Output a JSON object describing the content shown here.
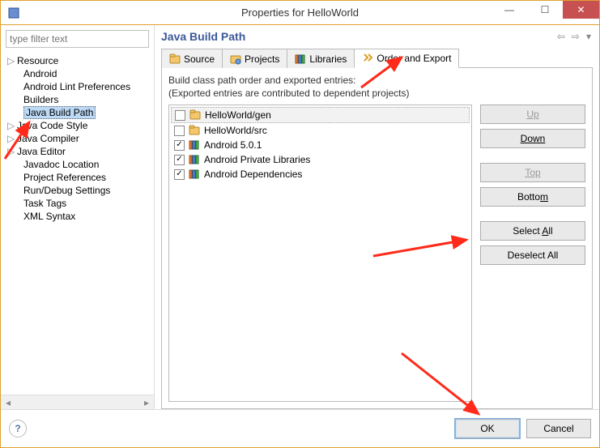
{
  "window": {
    "title": "Properties for HelloWorld"
  },
  "filter": {
    "placeholder": "type filter text"
  },
  "tree": [
    {
      "label": "Resource",
      "expandable": true
    },
    {
      "label": "Android"
    },
    {
      "label": "Android Lint Preferences"
    },
    {
      "label": "Builders"
    },
    {
      "label": "Java Build Path",
      "selected": true
    },
    {
      "label": "Java Code Style",
      "expandable": true
    },
    {
      "label": "Java Compiler",
      "expandable": true
    },
    {
      "label": "Java Editor",
      "expandable": true
    },
    {
      "label": "Javadoc Location"
    },
    {
      "label": "Project References"
    },
    {
      "label": "Run/Debug Settings"
    },
    {
      "label": "Task Tags"
    },
    {
      "label": "XML Syntax"
    }
  ],
  "page": {
    "title": "Java Build Path"
  },
  "tabs": [
    {
      "label": "Source",
      "icon": "source"
    },
    {
      "label": "Projects",
      "icon": "project"
    },
    {
      "label": "Libraries",
      "icon": "library"
    },
    {
      "label": "Order and Export",
      "icon": "order",
      "active": true
    }
  ],
  "description": {
    "line1": "Build class path order and exported entries:",
    "line2": "(Exported entries are contributed to dependent projects)"
  },
  "entries": [
    {
      "label": "HelloWorld/gen",
      "checked": false,
      "icon": "source",
      "selected": true
    },
    {
      "label": "HelloWorld/src",
      "checked": false,
      "icon": "source"
    },
    {
      "label": "Android 5.0.1",
      "checked": true,
      "icon": "library"
    },
    {
      "label": "Android Private Libraries",
      "checked": true,
      "icon": "library"
    },
    {
      "label": "Android Dependencies",
      "checked": true,
      "icon": "library"
    }
  ],
  "buttons": {
    "up": "Up",
    "down": "Down",
    "top": "Top",
    "bottom": "Bottom",
    "select_all": "Select All",
    "deselect_all": "Deselect All"
  },
  "footer": {
    "ok": "OK",
    "cancel": "Cancel"
  }
}
